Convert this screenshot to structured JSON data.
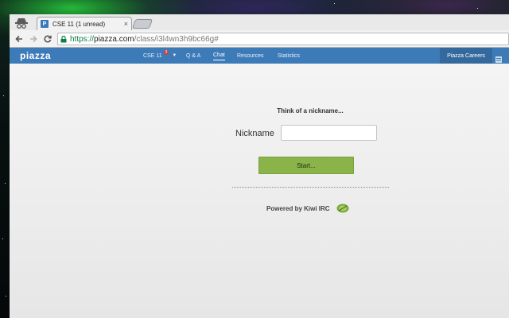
{
  "browser": {
    "tab_title": "CSE 11 (1 unread)",
    "tab_favicon_letter": "P",
    "close_glyph": "×",
    "url_scheme": "https://",
    "url_host": "piazza.com",
    "url_path": "/class/i3l4wn3h9bc66g#"
  },
  "header": {
    "logo": "piazza",
    "course": "CSE 11",
    "course_badge": "3",
    "qa": "Q & A",
    "chat": "Chat",
    "resources": "Resources",
    "statistics": "Statistics",
    "careers": "Piazza Careers",
    "accent_color": "#3d7ab8"
  },
  "chat": {
    "prompt": "Think of a nickname...",
    "nickname_label": "Nickname",
    "nickname_value": "",
    "start_label": "Start...",
    "powered_by": "Powered by Kiwi IRC",
    "button_color": "#8ab34a"
  },
  "icons": [
    "incognito-icon",
    "back-icon",
    "forward-icon",
    "reload-icon",
    "lock-icon",
    "menu-icon",
    "kiwi-icon"
  ]
}
